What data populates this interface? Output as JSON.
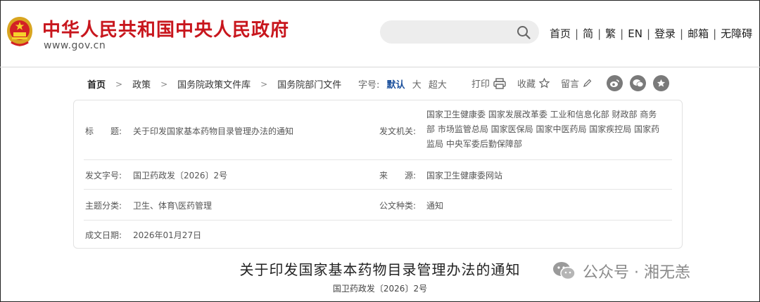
{
  "header": {
    "title": "中华人民共和国中央人民政府",
    "url": "www.gov.cn",
    "search_placeholder": "",
    "nav": [
      "首页",
      "简",
      "繁",
      "EN",
      "登录",
      "邮箱",
      "无障碍"
    ]
  },
  "breadcrumb": [
    "首页",
    "政策",
    "国务院政策文件库",
    "国务院部门文件"
  ],
  "font_size": {
    "label": "字号:",
    "options": [
      "默认",
      "大",
      "超大"
    ]
  },
  "tools": {
    "print": "打印",
    "favorite": "收藏",
    "comment": "留言"
  },
  "info": {
    "title_label": "标　　题:",
    "title_value": "关于印发国家基本药物目录管理办法的通知",
    "issuer_label": "发文机关:",
    "issuer_lines": [
      "国家卫生健康委  国家发展改革委  工业和信息化部  财政部  商务",
      "部  市场监管总局  国家医保局  国家中医药局  国家疾控局  国家药",
      "监局  中央军委后勤保障部"
    ],
    "doc_no_label": "发文字号:",
    "doc_no_value": "国卫药政发〔2026〕2号",
    "source_label": "来　　源:",
    "source_value": "国家卫生健康委网站",
    "topic_label": "主题分类:",
    "topic_value": "卫生、体育\\医药管理",
    "type_label": "公文种类:",
    "type_value": "通知",
    "date_label": "成文日期:",
    "date_value": "2026年01月27日"
  },
  "document": {
    "title": "关于印发国家基本药物目录管理办法的通知",
    "number": "国卫药政发〔2026〕2号"
  },
  "watermark": "公众号 · 湘无恙",
  "colors": {
    "brand_red": "#c8161d",
    "active_blue": "#1a4f9c"
  }
}
